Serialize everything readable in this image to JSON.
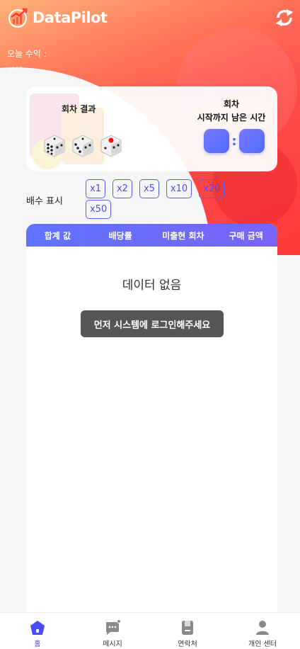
{
  "app": {
    "title": "DataPilot"
  },
  "stats": {
    "today_profit_label": "오늘 수익 :",
    "balance_label": "잔액 :"
  },
  "round_card": {
    "result_label": "회차 결과",
    "timer_label_line1": "회차",
    "timer_label_line2": "시작까지 남은 시간",
    "timer_separator": ":",
    "dice": [
      6,
      3,
      1
    ]
  },
  "multiplier": {
    "label": "배수 표시",
    "options": [
      "x1",
      "x2",
      "x5",
      "x10",
      "x20",
      "x50"
    ]
  },
  "table": {
    "columns": [
      "합계 값",
      "배당률",
      "미출현 회차",
      "구매 금액"
    ],
    "empty_text": "데이터 없음",
    "login_button": "먼저 시스템에 로그인해주세요"
  },
  "tabbar": {
    "items": [
      {
        "label": "홈",
        "icon": "home-icon",
        "active": true
      },
      {
        "label": "메시지",
        "icon": "message-icon",
        "active": false
      },
      {
        "label": "연락처",
        "icon": "contacts-icon",
        "active": false
      },
      {
        "label": "개인 센터",
        "icon": "user-icon",
        "active": false
      }
    ]
  },
  "colors": {
    "accent": "#4b4bff",
    "header_gradient_start": "#ffb27a",
    "header_gradient_end": "#ff3b3b",
    "table_head": "#6a6cfb"
  }
}
